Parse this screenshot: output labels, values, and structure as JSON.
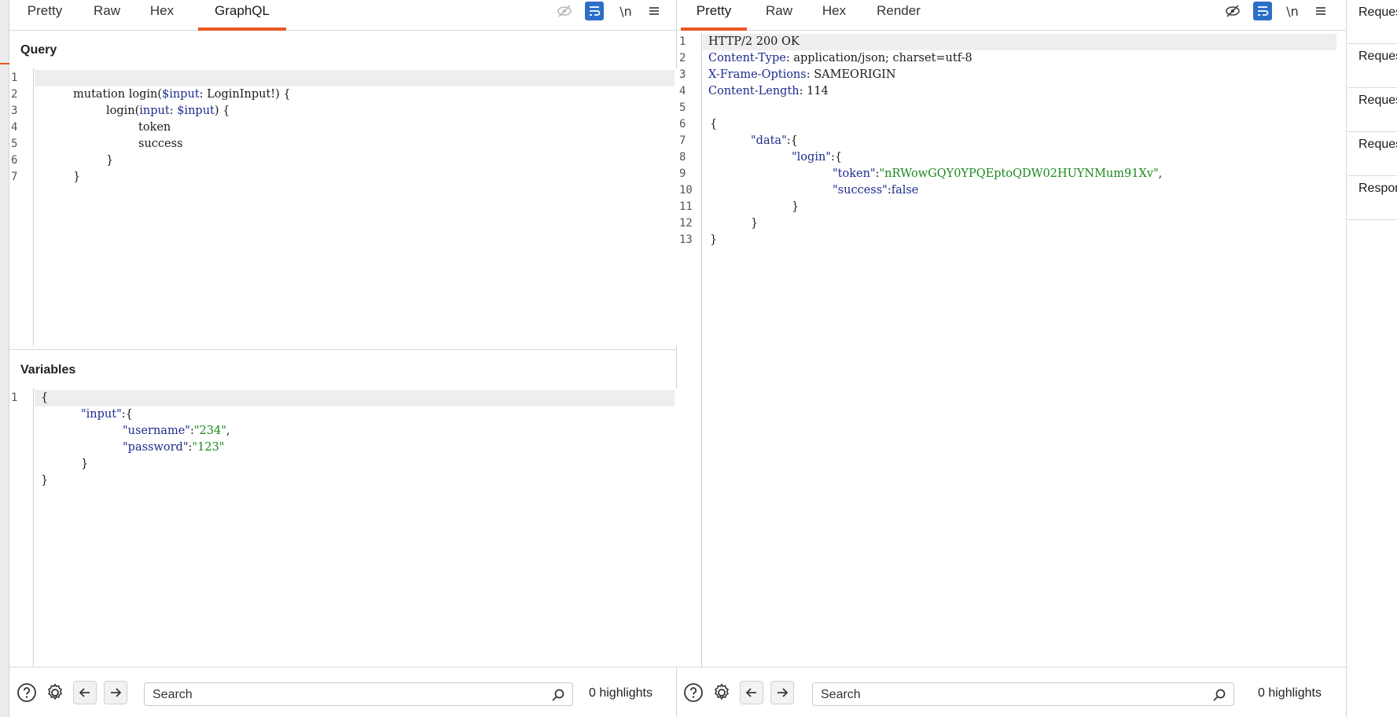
{
  "request": {
    "tabs": [
      {
        "label": "Pretty"
      },
      {
        "label": "Raw"
      },
      {
        "label": "Hex"
      },
      {
        "label": "GraphQL"
      }
    ],
    "active_tab": "GraphQL",
    "toolbar": {
      "newline_label": "\\n"
    },
    "query_title": "Query",
    "query_lines": [
      {
        "n": "1"
      },
      {
        "n": "2"
      },
      {
        "n": "3"
      },
      {
        "n": "4"
      },
      {
        "n": "5"
      },
      {
        "n": "6"
      },
      {
        "n": "7"
      }
    ],
    "query_code": {
      "l2_kw": "mutation login(",
      "l2_var": "$input",
      "l2_rest": ": LoginInput!) {",
      "l3_a": "login(",
      "l3_arg": "input",
      "l3_b": ": ",
      "l3_var": "$input",
      "l3_c": ") {",
      "l4": "token",
      "l5": "success",
      "l6": "}",
      "l7": "}"
    },
    "variables_title": "Variables",
    "variables_lines": [
      {
        "n": "1"
      }
    ],
    "variables_code": {
      "open": "{",
      "input_key": "\"input\"",
      "colon_brace": ":{",
      "username_key": "\"username\"",
      "username_val": "\"234\"",
      "password_key": "\"password\"",
      "password_val": "\"123\"",
      "comma": ",",
      "colon": ":",
      "inner_close": "}",
      "close": "}"
    },
    "search": {
      "placeholder": "Search"
    },
    "highlights": "0 highlights"
  },
  "response": {
    "tabs": [
      {
        "label": "Pretty"
      },
      {
        "label": "Raw"
      },
      {
        "label": "Hex"
      },
      {
        "label": "Render"
      }
    ],
    "active_tab": "Pretty",
    "toolbar": {
      "newline_label": "\\n"
    },
    "line_numbers": [
      "1",
      "2",
      "3",
      "4",
      "5",
      "6",
      "7",
      "8",
      "9",
      "10",
      "11",
      "12",
      "13"
    ],
    "headers": {
      "status": "HTTP/2 200 OK",
      "content_type_key": "Content-Type",
      "content_type_val": "application/json; charset=utf-8",
      "xfo_key": "X-Frame-Options",
      "xfo_val": "SAMEORIGIN",
      "cl_key": "Content-Length",
      "cl_val": "114",
      "sep": ": "
    },
    "body": {
      "open": "{",
      "data_key": "\"data\"",
      "login_key": "\"login\"",
      "token_key": "\"token\"",
      "token_val": "\"nRWowGQY0YPQEptoQDW02HUYNMum91Xv\"",
      "success_key": "\"success\"",
      "success_val": "false",
      "colon_brace": ":{",
      "colon": ":",
      "comma": ",",
      "close": "}"
    },
    "search": {
      "placeholder": "Search"
    },
    "highlights": "0 highlights"
  },
  "side_panel": {
    "items": [
      {
        "label": "Request attributes"
      },
      {
        "label": "Request query parameters"
      },
      {
        "label": "Request body parameters"
      },
      {
        "label": "Request cookies"
      },
      {
        "label": "Response headers"
      }
    ]
  },
  "colors": {
    "accent": "#e8561f",
    "keyword": "#1c2b8c",
    "string": "#1c8a1c",
    "wrap_toggle": "#2b6fc7"
  },
  "icons": [
    "eye-off-icon",
    "wrap-icon",
    "menu-icon",
    "help-icon",
    "gear-icon",
    "arrow-left-icon",
    "arrow-right-icon",
    "search-icon"
  ]
}
